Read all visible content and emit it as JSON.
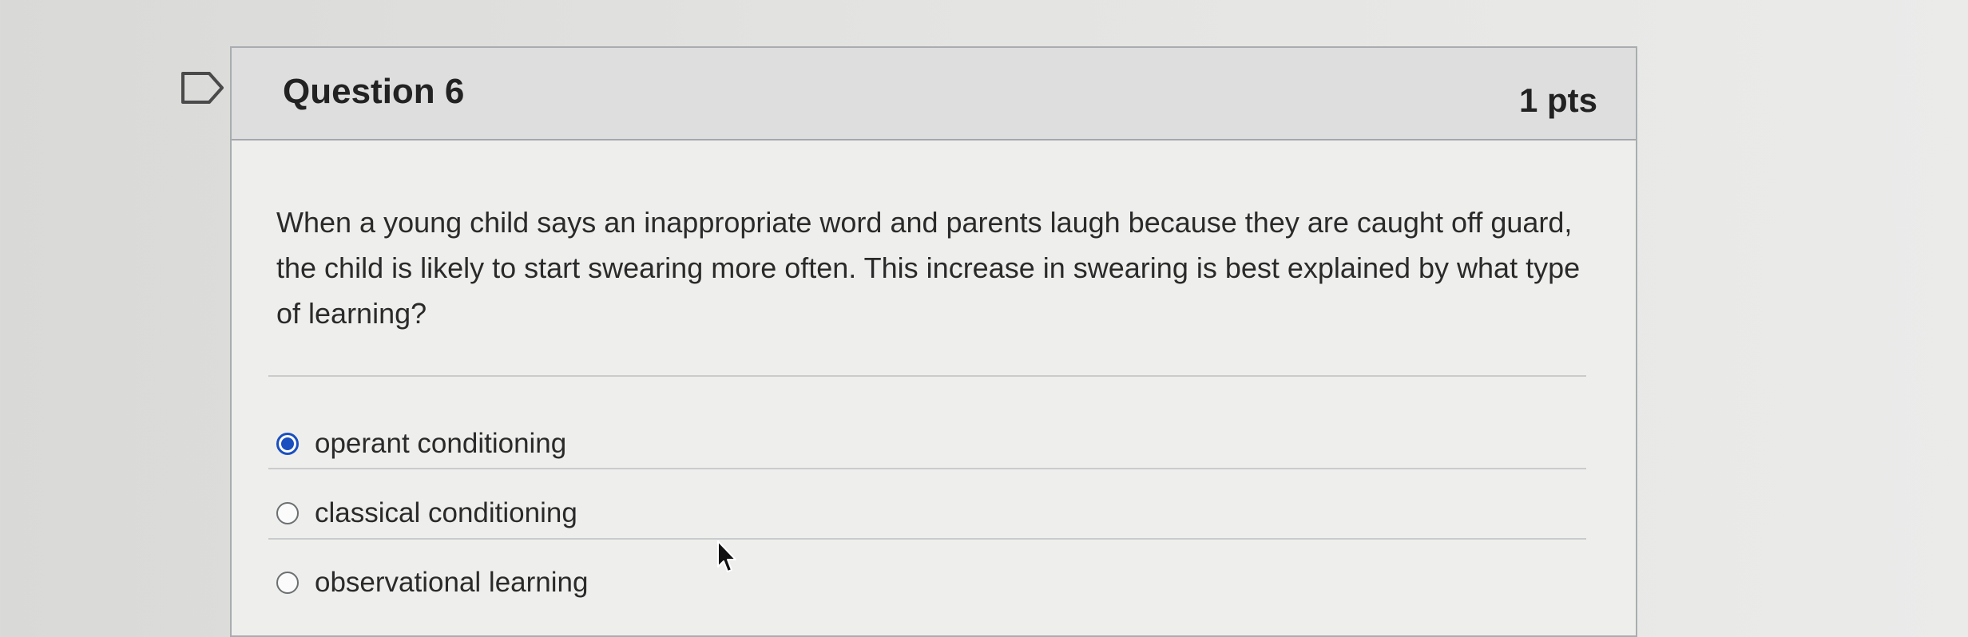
{
  "question": {
    "title": "Question 6",
    "points": "1 pts",
    "text": "When a young child says an inappropriate word and parents laugh because they are caught off guard, the child is likely to start swearing more often. This increase in swearing is best explained by what type of learning?",
    "answers": [
      {
        "label": "operant conditioning",
        "selected": true
      },
      {
        "label": "classical conditioning",
        "selected": false
      },
      {
        "label": "observational learning",
        "selected": false
      }
    ]
  },
  "icons": {
    "flag": "bookmark-flag-icon",
    "cursor": "mouse-pointer-icon"
  },
  "colors": {
    "selected_radio": "#1a4fbf",
    "header_bg": "#dedede"
  }
}
